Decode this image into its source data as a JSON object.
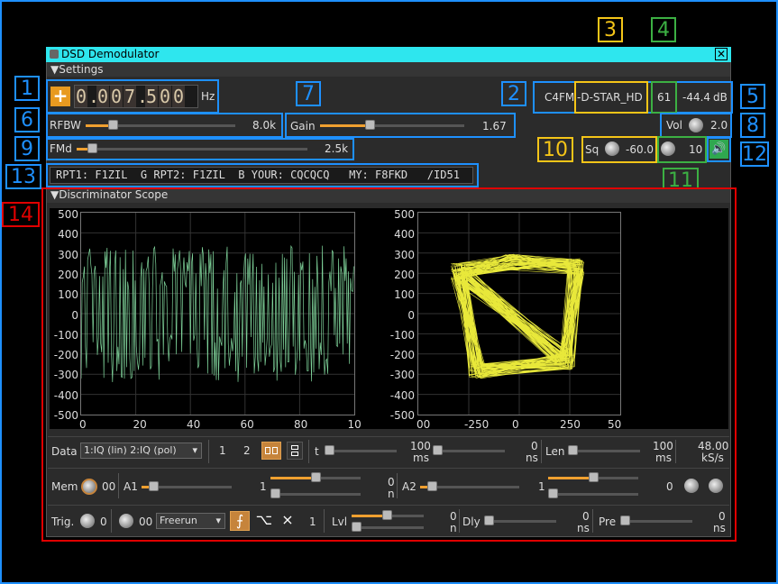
{
  "window": {
    "title": "DSD Demodulator"
  },
  "settings_header": "Settings",
  "freq": {
    "digits": [
      "0",
      ".",
      "0",
      "0",
      "7",
      ".",
      "5",
      "0",
      "0"
    ],
    "unit": "Hz"
  },
  "status": {
    "mode": "C4FM",
    "standard": "-D-STAR_HD",
    "sync": "61",
    "power": "-44.4",
    "power_unit": "dB"
  },
  "rfbw": {
    "label": "RFBW",
    "value": "8.0k",
    "level": 0.18
  },
  "gain": {
    "label": "Gain",
    "value": "1.67",
    "level": 0.3
  },
  "fmd": {
    "label": "FMd",
    "value": "2.5k",
    "level": 0.05
  },
  "vol": {
    "label": "Vol",
    "value": "2.0"
  },
  "sq": {
    "label": "Sq",
    "value": "-60.0",
    "gate": "10"
  },
  "info_text": "RPT1: F1ZIL  G RPT2: F1ZIL  B YOUR: CQCQCQ   MY: F8FKD   /ID51",
  "callouts": [
    "1",
    "2",
    "3",
    "4",
    "5",
    "6",
    "7",
    "8",
    "9",
    "10",
    "11",
    "12",
    "13",
    "14"
  ],
  "scope_header": "Discriminator Scope",
  "scope": {
    "left_y_ticks": [
      "500",
      "400",
      "300",
      "200",
      "100",
      "0",
      "-100",
      "-200",
      "-300",
      "-400",
      "-500"
    ],
    "left_x_ticks": [
      "0",
      "20",
      "40",
      "60",
      "80",
      "10"
    ],
    "right_y_ticks": [
      "500",
      "400",
      "300",
      "200",
      "100",
      "0",
      "-100",
      "-200",
      "-300",
      "-400",
      "-500"
    ],
    "right_x_ticks": [
      "00",
      "-250",
      "0",
      "250",
      "50"
    ],
    "trace_color": "#7fd39a",
    "xy_color": "#e8e83a"
  },
  "controls": {
    "data_label": "Data",
    "data_select": "1:IQ (lin) 2:IQ (pol)",
    "trace1": "1",
    "trace2": "2",
    "t_label": "t",
    "t_value": "100",
    "t_unit": "ms",
    "ofs_value": "0",
    "ofs_unit": "ns",
    "len_label": "Len",
    "len_value": "100",
    "len_unit": "ms",
    "rate_value": "48.00",
    "rate_unit": "kS/s",
    "mem_label": "Mem",
    "mem_value": "00",
    "a1_label": "A1",
    "a1_gain": "1",
    "a1_ofs": "0",
    "a1_ofs_unit": "n",
    "a2_label": "A2",
    "a2_gain": "1",
    "a2_ofs": "0",
    "trig_label": "Trig.",
    "trig_index": "0",
    "trig_mem": "00",
    "trig_mode": "Freerun",
    "trig_count": "1",
    "lvl_label": "Lvl",
    "lvl_value": "0",
    "lvl_unit": "n",
    "dly_label": "Dly",
    "dly_value": "0",
    "dly_unit": "ns",
    "pre_label": "Pre",
    "pre_value": "0",
    "pre_unit": "ns"
  }
}
